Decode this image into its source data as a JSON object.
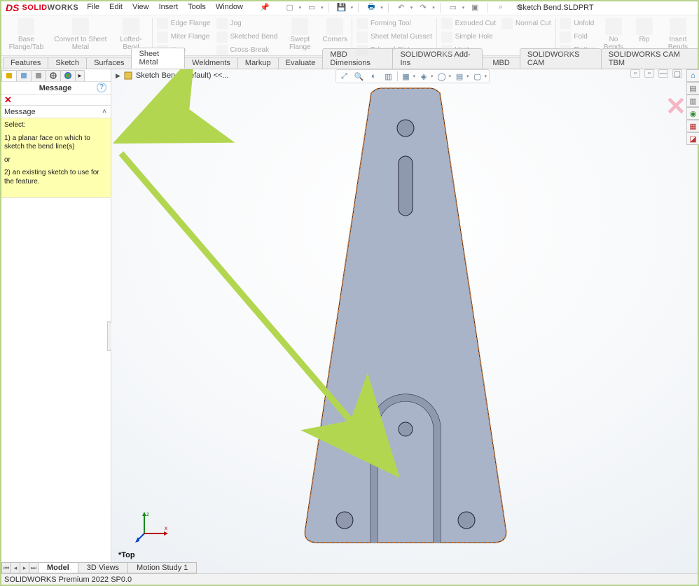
{
  "app": {
    "brand_solid": "SOLID",
    "brand_works": "WORKS",
    "doc_title": "Sketch Bend.SLDPRT"
  },
  "menu": {
    "items": [
      "File",
      "Edit",
      "View",
      "Insert",
      "Tools",
      "Window"
    ]
  },
  "qat": {
    "icons": [
      "new",
      "open",
      "save",
      "print",
      "undo",
      "redo",
      "select",
      "rebuild",
      "options",
      "search",
      "settings"
    ]
  },
  "ribbon": {
    "big": [
      {
        "label": "Base Flange/Tab"
      },
      {
        "label": "Convert to Sheet Metal"
      },
      {
        "label": "Lofted-Bend"
      }
    ],
    "col1": [
      "Edge Flange",
      "Miter Flange",
      "Hem"
    ],
    "col2": [
      "Jog",
      "Sketched Bend",
      "Cross-Break"
    ],
    "big2": [
      {
        "label": "Swept Flange"
      },
      {
        "label": "Corners"
      }
    ],
    "col3": [
      "Forming Tool",
      "Sheet Metal Gusset",
      "Tab and Slot"
    ],
    "col4": [
      "Extruded Cut",
      "Simple Hole",
      "Vent"
    ],
    "col5": [
      "Normal Cut"
    ],
    "col6": [
      "Unfold",
      "Fold",
      "Flatten"
    ],
    "big3": [
      {
        "label": "No Bends"
      },
      {
        "label": "Rip"
      },
      {
        "label": "Insert Bends"
      }
    ]
  },
  "tabs": [
    "Features",
    "Sketch",
    "Surfaces",
    "Sheet Metal",
    "Weldments",
    "Markup",
    "Evaluate",
    "MBD Dimensions",
    "SOLIDWORKS Add-Ins",
    "MBD",
    "SOLIDWORKS CAM",
    "SOLIDWORKS CAM TBM"
  ],
  "active_tab": "Sheet Metal",
  "breadcrumb": "Sketch Bend (Default) <<...",
  "hud_icons": [
    "zoom-fit",
    "zoom-area",
    "prev-view",
    "section",
    "display-style",
    "scene",
    "hide-show",
    "edit-appearance",
    "apply-scene",
    "view-settings"
  ],
  "winctrl": [
    "left-icon",
    "right-icon",
    "minimize",
    "restore",
    "close"
  ],
  "property_manager": {
    "title": "Message",
    "section_label": "Message",
    "select_label": "Select:",
    "line1": "1) a planar face on which to sketch the bend line(s)",
    "or": "or",
    "line2": "2) an existing sketch to use for the feature."
  },
  "taskpane_icons": [
    "home",
    "resources",
    "design-library",
    "view-palette",
    "appearances",
    "custom-props"
  ],
  "bottom_tabs": [
    "Model",
    "3D Views",
    "Motion Study 1"
  ],
  "active_bottom_tab": "Model",
  "view_label": "*Top",
  "status_text": "SOLIDWORKS Premium 2022 SP0.0",
  "colors": {
    "accent_green": "#b3d651",
    "sw_red": "#d9001b",
    "note_bg": "#ffffb0",
    "part_fill": "#a9b4c9",
    "part_edge_sel": "#c77a3a"
  }
}
